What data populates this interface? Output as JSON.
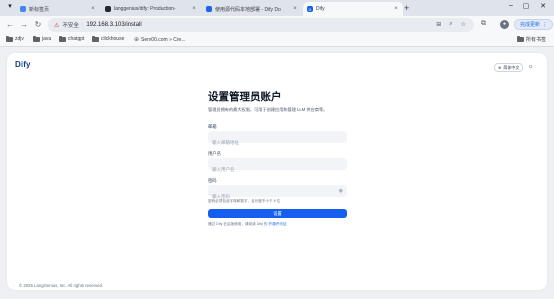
{
  "browser": {
    "tabs": [
      {
        "label": "新标签页",
        "active": false,
        "icon": "chrome-icon"
      },
      {
        "label": "langgenius/dify: Production-",
        "active": false,
        "icon": "github-icon"
      },
      {
        "label": "使用源代码本地部署 - Dify Do",
        "active": false,
        "icon": "dify-doc-icon"
      },
      {
        "label": "Dify",
        "active": true,
        "icon": "dify-icon"
      }
    ],
    "new_tab": "+",
    "security_label": "不安全",
    "url": "192.168.3.103/install",
    "update_label": "完成更新",
    "bookmarks": [
      {
        "label": "zdjv",
        "icon": "folder-icon"
      },
      {
        "label": "java",
        "icon": "folder-icon"
      },
      {
        "label": "chatgpt",
        "icon": "folder-icon"
      },
      {
        "label": "clickhouse",
        "icon": "folder-icon"
      },
      {
        "label": "Serv00.com » Cre...",
        "icon": "site-icon"
      }
    ],
    "all_bookmarks_label": "所有书签"
  },
  "app": {
    "logo_d": "D",
    "logo_i": "i",
    "logo_rest": "fy",
    "language_label": "简体中文",
    "title": "设置管理员账户",
    "subtitle": "管理员拥有的最大权限，可用于创建应用和管理 LLM 供应商等。",
    "email": {
      "label": "邮箱",
      "placeholder": "输入邮箱地址"
    },
    "username": {
      "label": "用户名",
      "placeholder": "输入用户名"
    },
    "password": {
      "label": "密码",
      "placeholder": "输入密码",
      "hint": "密码必须包含字母和数字，且长度不小于 8 位"
    },
    "submit_label": "设置",
    "agreement_prefix": "通过 Dify 社区版使用，请阅读 Dify 的",
    "agreement_link": "开源许可证",
    "footer": "© 2025 LangGenius, Inc. All rights reserved."
  },
  "colors": {
    "accent": "#155eef",
    "logo": "#1c3b75"
  }
}
